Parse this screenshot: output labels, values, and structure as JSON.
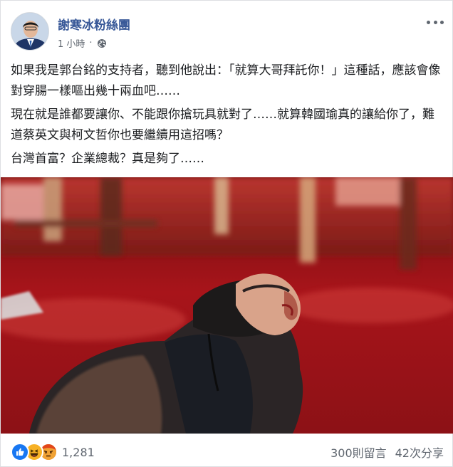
{
  "post": {
    "page_name": "謝寒冰粉絲團",
    "time": "1 小時",
    "separator": "·",
    "audience_icon": "globe-icon",
    "paragraphs": [
      "如果我是郭台銘的支持者，聽到他說出：「就算大哥拜託你！」這種話，應該會像對穿腸一樣嘔出幾十兩血吧……",
      "現在就是誰都要讓你、不能跟你搶玩具就對了……就算韓國瑜真的讓給你了，難道蔡英文與柯文哲你也要繼續用這招嗎？",
      "台灣首富？企業總裁？真是夠了……"
    ]
  },
  "footer": {
    "reaction_icons": [
      "like-icon",
      "haha-icon",
      "angry-icon"
    ],
    "reaction_count": "1,281",
    "comments": "300則留言",
    "shares": "42次分享"
  },
  "colors": {
    "page_name": "#385898",
    "meta": "#606770",
    "like": "#1877f2",
    "haha": "#f7b125",
    "angry": "#e9710f"
  }
}
